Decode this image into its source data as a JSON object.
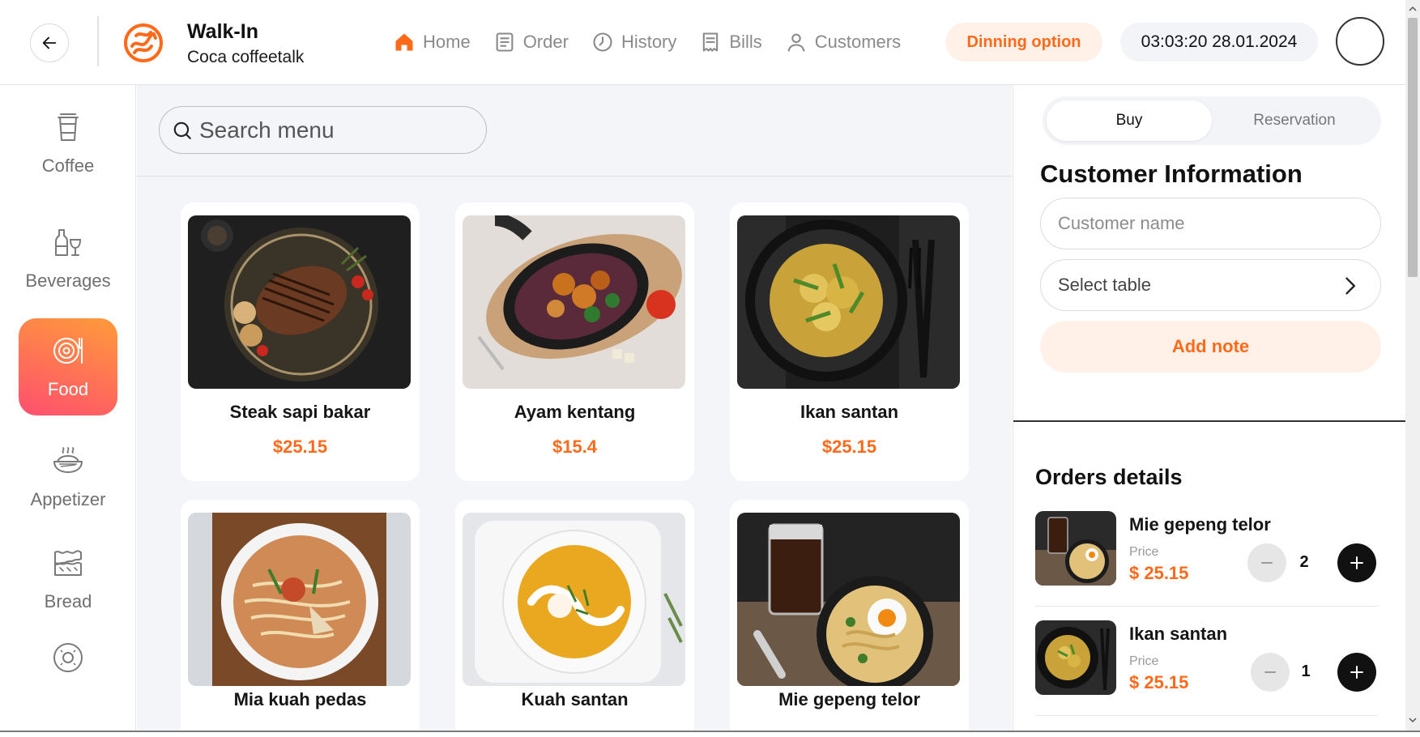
{
  "header": {
    "title": "Walk-In",
    "subtitle": "Coca coffeetalk",
    "nav": [
      {
        "label": "Home",
        "icon": "home-icon"
      },
      {
        "label": "Order",
        "icon": "order-icon"
      },
      {
        "label": "History",
        "icon": "clock-icon"
      },
      {
        "label": "Bills",
        "icon": "bill-icon"
      },
      {
        "label": "Customers",
        "icon": "user-icon"
      }
    ],
    "dining_option": "Dinning option",
    "datetime": "03:03:20 28.01.2024",
    "accent_color": "#ff6a1a"
  },
  "sidebar": {
    "categories": [
      {
        "label": "Coffee",
        "icon": "coffee-cup-icon"
      },
      {
        "label": "Beverages",
        "icon": "bottle-glass-icon"
      },
      {
        "label": "Food",
        "icon": "plate-icon",
        "active": true
      },
      {
        "label": "Appetizer",
        "icon": "steaming-bowl-icon"
      },
      {
        "label": "Bread",
        "icon": "bread-icon"
      }
    ]
  },
  "main": {
    "search_placeholder": "Search menu",
    "items": [
      {
        "name": "Steak sapi bakar",
        "price": "$25.15"
      },
      {
        "name": "Ayam kentang",
        "price": "$15.4"
      },
      {
        "name": "Ikan santan",
        "price": "$25.15"
      },
      {
        "name": "Mia kuah pedas",
        "price": ""
      },
      {
        "name": "Kuah santan",
        "price": ""
      },
      {
        "name": "Mie gepeng telor",
        "price": ""
      }
    ]
  },
  "panel": {
    "tabs": [
      "Buy",
      "Reservation"
    ],
    "active_tab": "Buy",
    "customer_title": "Customer Information",
    "customer_name_placeholder": "Customer name",
    "select_table_label": "Select table",
    "add_note_label": "Add note",
    "orders_title": "Orders details",
    "orders": [
      {
        "name": "Mie gepeng telor",
        "price_label": "Price",
        "price": "$ 25.15",
        "qty": "2"
      },
      {
        "name": "Ikan santan",
        "price_label": "Price",
        "price": "$ 25.15",
        "qty": "1"
      }
    ]
  }
}
